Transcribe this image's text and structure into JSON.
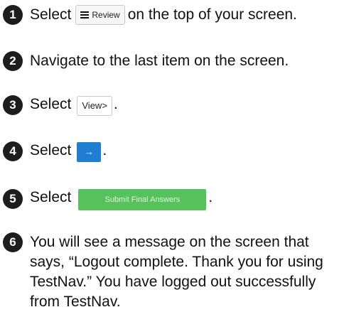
{
  "steps": [
    {
      "number": "1",
      "before": "Select",
      "button": "Review",
      "after": "on the top of your screen."
    },
    {
      "number": "2",
      "text": "Navigate to the last item on the screen."
    },
    {
      "number": "3",
      "before": "Select",
      "button": "View>",
      "after": "."
    },
    {
      "number": "4",
      "before": "Select",
      "button": "→",
      "after": "."
    },
    {
      "number": "5",
      "before": "Select",
      "button": "Submit Final Answers",
      "after": "."
    },
    {
      "number": "6",
      "text": "You will see a message on the screen that says, “Logout complete. Thank you for using TestNav.” You have logged out successfully from TestNav."
    }
  ],
  "icons": {
    "review": "list-icon"
  },
  "colors": {
    "arrow_button": "#1f7ed1",
    "submit_button": "#57c25b",
    "step_circle": "#1d1d1d"
  }
}
